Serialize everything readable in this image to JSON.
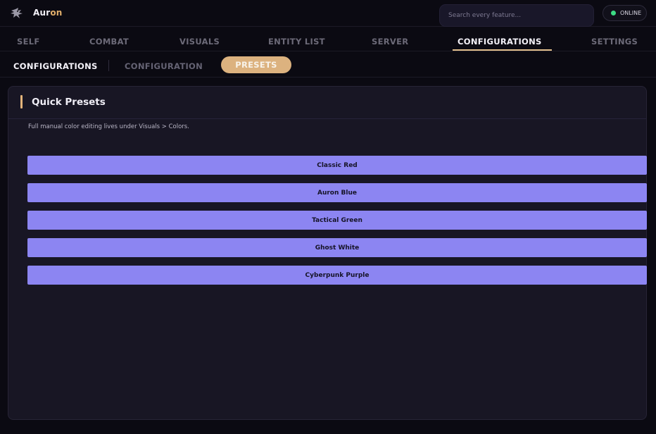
{
  "app": {
    "brand_part1": "Aur",
    "brand_part2": "on",
    "logo_icon": "bird-emblem-icon"
  },
  "header": {
    "search_placeholder": "Search every feature...",
    "status_label": "ONLINE",
    "status_color": "#3ddc84"
  },
  "main_tabs": {
    "self": "SELF",
    "combat": "COMBAT",
    "visuals": "VISUALS",
    "entity_list": "ENTITY LIST",
    "server": "SERVER",
    "configurations": "CONFIGURATIONS",
    "settings": "SETTINGS",
    "active": "CONFIGURATIONS"
  },
  "sub_tabs": {
    "current_section": "CONFIGURATIONS",
    "configuration": "CONFIGURATION",
    "presets": "PRESETS",
    "active": "PRESETS"
  },
  "panel": {
    "title": "Quick Presets",
    "note": "Full manual color editing lives under Visuals > Colors.",
    "presets": [
      "Classic Red",
      "Auron Blue",
      "Tactical Green",
      "Ghost White",
      "Cyberpunk Purple"
    ]
  },
  "colors": {
    "accent": "#e3b47a",
    "button": "#8c85f2",
    "panel_bg": "#181624",
    "page_bg": "#0b0a12"
  }
}
